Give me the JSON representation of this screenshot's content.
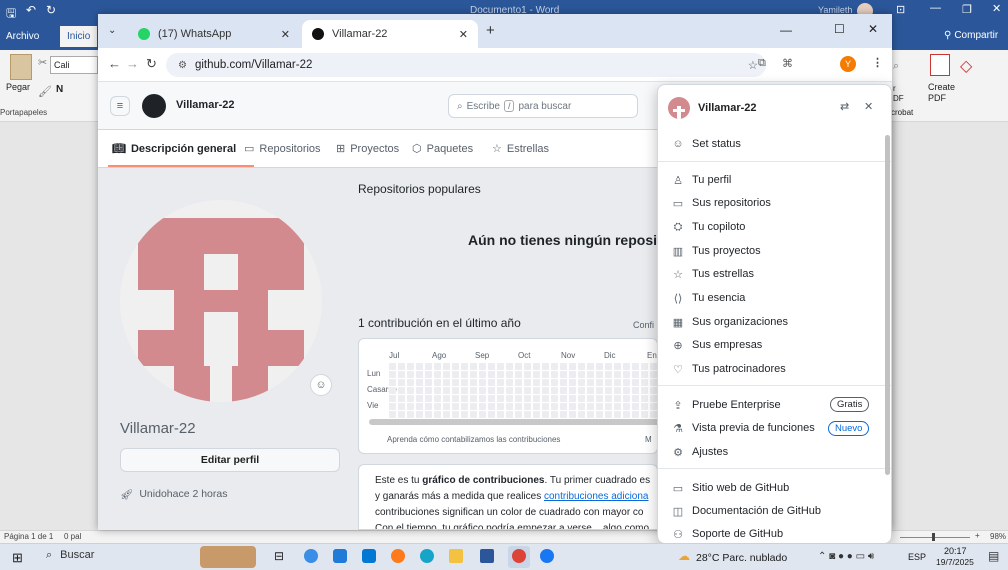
{
  "word": {
    "title": "Documento1 - Word",
    "user": "Yamileth",
    "tab_archivo": "Archivo",
    "tab_inicio": "Inicio",
    "share": "Compartir",
    "paste": "Pegar",
    "clipboard": "Portapapeles",
    "font_box": "Cali",
    "bold_n": "N",
    "create_pdf": "Create PDF",
    "adobe_partial": "crobat",
    "partial_r": "r",
    "partial_df": "DF",
    "status_page": "Página 1 de 1",
    "status_words": "0 pal",
    "zoom": "98%"
  },
  "chrome": {
    "tabs": [
      {
        "label": "(17) WhatsApp"
      },
      {
        "label": "Villamar-22"
      }
    ],
    "url": "github.com/Villamar-22"
  },
  "github": {
    "username": "Villamar-22",
    "search_placeholder": "Escribe",
    "search_key": "/",
    "search_suffix": "para buscar",
    "nav": [
      "Descripción general",
      "Repositorios",
      "Proyectos",
      "Paquetes",
      "Estrellas"
    ],
    "profile_name": "Villamar-22",
    "edit_profile": "Editar perfil",
    "joined": "Unidohace 2 horas",
    "popular_repos": "Repositorios populares",
    "no_repos": "Aún no tienes ningún reposi",
    "contributions_title": "1 contribución en el último año",
    "contrib_settings": "Confi",
    "months": [
      "Jul",
      "Ago",
      "Sep",
      "Oct",
      "Nov",
      "Dic",
      "Ene"
    ],
    "days": [
      "Lun",
      "Casarse",
      "Vie"
    ],
    "learn_link": "Aprenda cómo contabilizamos las contribuciones",
    "learn_more_partial": "M",
    "info_prefix": "Este es tu ",
    "info_bold": "gráfico de contribuciones",
    "info_text1": ". Tu primer cuadrado es",
    "info_text2": "y ganarás más a medida que realices ",
    "info_link": "contribuciones adiciona",
    "info_text3": "contribuciones significan un color de cuadrado con mayor co",
    "info_text4": "Con el tiempo, tu gráfico podría empezar a verse... algo como"
  },
  "menu": {
    "username": "Villamar-22",
    "set_status": "Set status",
    "items1": [
      {
        "label": "Tu perfil",
        "icon": "person-icon"
      },
      {
        "label": "Sus repositorios",
        "icon": "repo-icon"
      },
      {
        "label": "Tu copiloto",
        "icon": "copilot-icon"
      },
      {
        "label": "Tus proyectos",
        "icon": "project-icon"
      },
      {
        "label": "Tus estrellas",
        "icon": "star-icon"
      },
      {
        "label": "Tu esencia",
        "icon": "code-square-icon"
      },
      {
        "label": "Sus organizaciones",
        "icon": "organization-icon"
      },
      {
        "label": "Sus empresas",
        "icon": "globe-icon"
      },
      {
        "label": "Tus patrocinadores",
        "icon": "heart-icon"
      }
    ],
    "try_enterprise": "Pruebe Enterprise",
    "badge_free": "Gratis",
    "feature_preview": "Vista previa de funciones",
    "badge_new": "Nuevo",
    "settings": "Ajustes",
    "items3": [
      {
        "label": "Sitio web de GitHub",
        "icon": "browser-icon"
      },
      {
        "label": "Documentación de GitHub",
        "icon": "book-icon"
      },
      {
        "label": "Soporte de GitHub",
        "icon": "people-icon"
      }
    ]
  },
  "taskbar": {
    "search": "Buscar",
    "weather": "28°C  Parc. nublado",
    "lang": "ESP",
    "time": "20:17",
    "date": "19/7/2025"
  },
  "colors": {
    "avatar": "#d28a8e",
    "avatar_bg": "#f0f0f0",
    "chrome_frame": "#dbe4f2",
    "word_blue": "#2b579a",
    "accent": "#0969da"
  }
}
